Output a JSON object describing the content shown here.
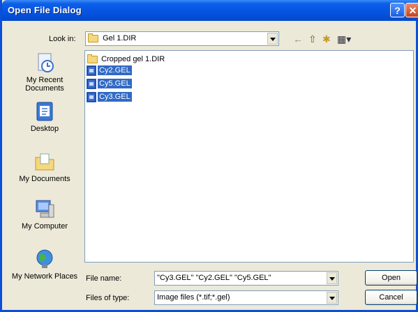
{
  "window": {
    "title": "Open File Dialog",
    "help_glyph": "?",
    "close_glyph": "✕"
  },
  "lookin": {
    "label": "Look in:",
    "value": "Gel 1.DIR"
  },
  "toolbar": {
    "back_glyph": "←",
    "up_glyph": "⇧",
    "new_folder_glyph": "✱",
    "views_glyph": "▦▾"
  },
  "places": [
    {
      "label": "My Recent Documents",
      "icon": "recent-documents-icon"
    },
    {
      "label": "Desktop",
      "icon": "desktop-icon"
    },
    {
      "label": "My Documents",
      "icon": "my-documents-icon"
    },
    {
      "label": "My Computer",
      "icon": "my-computer-icon"
    },
    {
      "label": "My Network Places",
      "icon": "network-places-icon"
    }
  ],
  "files": [
    {
      "name": "Cropped gel 1.DIR",
      "type": "folder",
      "selected": false
    },
    {
      "name": "Cy2.GEL",
      "type": "file",
      "selected": true
    },
    {
      "name": "Cy5.GEL",
      "type": "file",
      "selected": true
    },
    {
      "name": "Cy3.GEL",
      "type": "file",
      "selected": true
    }
  ],
  "filename": {
    "label": "File name:",
    "value": "\"Cy3.GEL\" \"Cy2.GEL\" \"Cy5.GEL\""
  },
  "filetype": {
    "label": "Files of type:",
    "value": "Image files (*.tif;*.gel)"
  },
  "buttons": {
    "open": "Open",
    "cancel": "Cancel"
  },
  "colors": {
    "titlebar": "#0553e0",
    "selection": "#316ac5",
    "dialog_bg": "#ece9d8"
  }
}
